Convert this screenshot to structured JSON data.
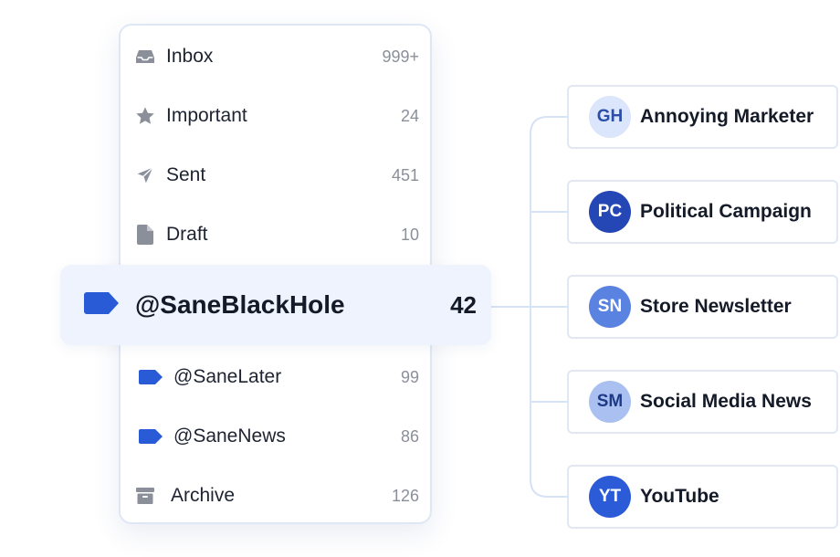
{
  "folders": [
    {
      "label": "Inbox",
      "count": "999+",
      "icon": "inbox-icon"
    },
    {
      "label": "Important",
      "count": "24",
      "icon": "star-icon"
    },
    {
      "label": "Sent",
      "count": "451",
      "icon": "send-icon"
    },
    {
      "label": "Draft",
      "count": "10",
      "icon": "file-icon"
    }
  ],
  "highlight": {
    "label": "@SaneBlackHole",
    "count": "42",
    "icon": "tag-icon"
  },
  "labels": [
    {
      "label": "@SaneLater",
      "count": "99",
      "icon": "tag-icon"
    },
    {
      "label": "@SaneNews",
      "count": "86",
      "icon": "tag-icon"
    },
    {
      "label": "Archive",
      "count": "126",
      "icon": "archive-icon"
    }
  ],
  "senders": [
    {
      "initials": "GH",
      "name": "Annoying Marketer",
      "bg": "#dbe5fb",
      "fg": "#2b4fa8"
    },
    {
      "initials": "PC",
      "name": "Political Campaign",
      "bg": "#2447b5",
      "fg": "#ffffff"
    },
    {
      "initials": "SN",
      "name": "Store Newsletter",
      "bg": "#5a82e0",
      "fg": "#ffffff"
    },
    {
      "initials": "SM",
      "name": "Social Media News",
      "bg": "#a9c0f1",
      "fg": "#1e3a86"
    },
    {
      "initials": "YT",
      "name": "YouTube",
      "bg": "#2c5bd8",
      "fg": "#ffffff"
    }
  ],
  "colors": {
    "accent": "#2a5bd7",
    "icon_gray": "#8a8f9a",
    "line": "#d6e2f5"
  }
}
